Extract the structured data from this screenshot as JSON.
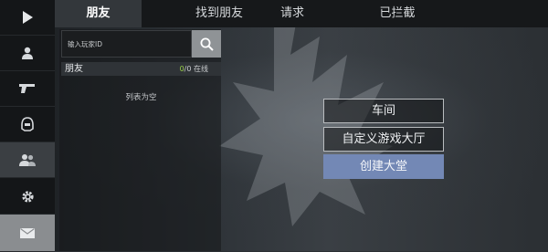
{
  "tabs": [
    {
      "label": "朋友",
      "active": true
    },
    {
      "label": "找到朋友",
      "active": false
    },
    {
      "label": "请求",
      "active": false
    },
    {
      "label": "已拦截",
      "active": false
    }
  ],
  "sidebar": {
    "items": [
      {
        "icon": "play-icon"
      },
      {
        "icon": "user-icon"
      },
      {
        "icon": "pistol-icon"
      },
      {
        "icon": "helmet-icon"
      },
      {
        "icon": "friends-icon",
        "active": true
      },
      {
        "icon": "gear-icon"
      },
      {
        "icon": "mail-icon"
      }
    ]
  },
  "search": {
    "placeholder": "输入玩家ID",
    "button_icon": "search-icon"
  },
  "friends_list": {
    "title": "朋友",
    "online_count": "0",
    "count_suffix": "/0 在线",
    "empty_text": "列表为空"
  },
  "actions": {
    "garage_label": "车间",
    "custom_lobby_label": "自定义游戏大厅",
    "create_lobby_label": "创建大堂"
  },
  "colors": {
    "accent": "#7388b5",
    "online": "#9bd14a",
    "rail": "#141618"
  }
}
